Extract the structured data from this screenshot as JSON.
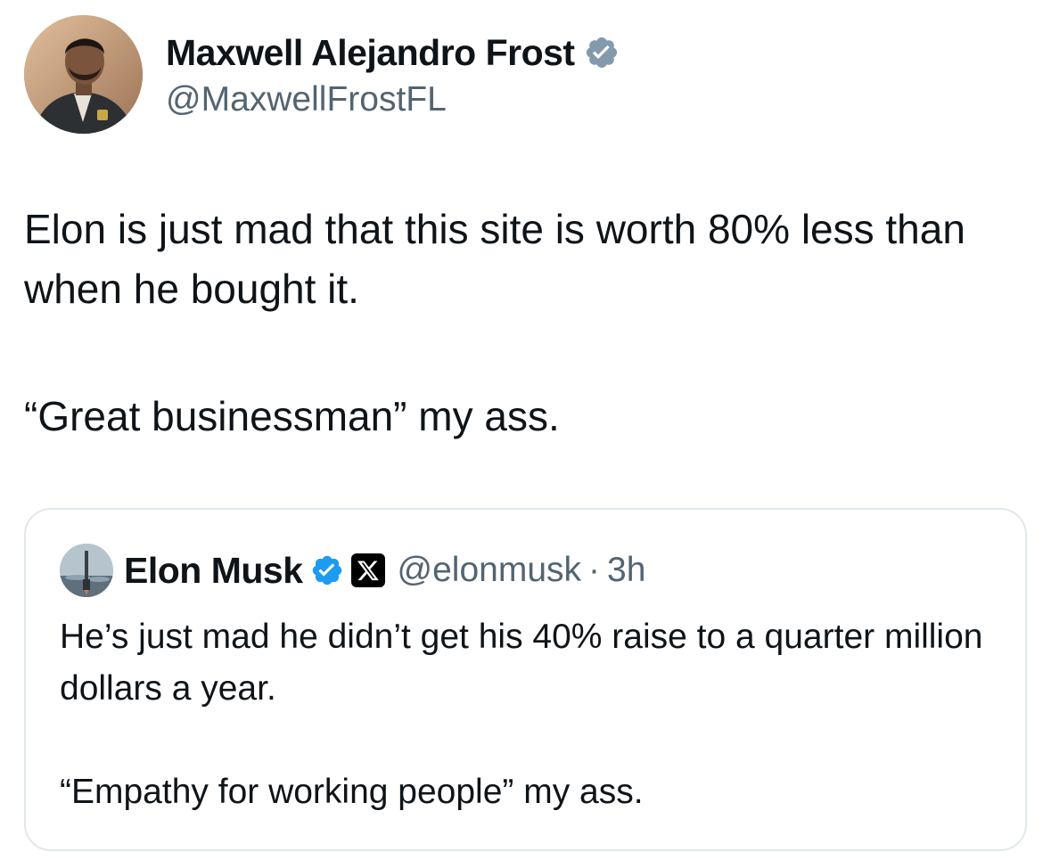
{
  "tweet": {
    "author": {
      "display_name": "Maxwell Alejandro Frost",
      "handle": "@MaxwellFrostFL",
      "verified": true,
      "verified_icon": "verified-badge-icon",
      "verified_color": "#829aab"
    },
    "text_paragraph_1": "Elon is just mad that this site is worth 80% less than when he bought it.",
    "text_paragraph_2": "“Great businessman” my ass."
  },
  "quoted_tweet": {
    "author": {
      "display_name": "Elon Musk",
      "handle": "@elonmusk",
      "verified": true,
      "verified_icon": "verified-badge-icon",
      "verified_color": "#1d9bf0",
      "affiliation_icon": "x-logo-icon"
    },
    "separator": "·",
    "timestamp": "3h",
    "text_paragraph_1": "He’s just mad he didn’t get his 40% raise to a quarter million dollars a year.",
    "text_paragraph_2": "“Empathy for working people” my ass."
  },
  "colors": {
    "text_primary": "#0f1419",
    "text_secondary": "#536471",
    "border": "#e1e8ed"
  }
}
